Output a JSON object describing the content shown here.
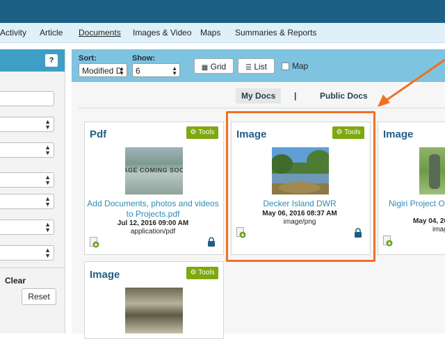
{
  "nav": {
    "items": [
      "Activity",
      "Article",
      "Documents",
      "Images & Video",
      "Maps",
      "Summaries & Reports"
    ],
    "active": "Documents"
  },
  "sidebar": {
    "help_label": "?",
    "clear_label": "Clear",
    "reset_label": "Reset"
  },
  "toolbar": {
    "sort_label": "Sort:",
    "sort_value": "Modified D",
    "show_label": "Show:",
    "show_value": "6",
    "grid_label": "Grid",
    "list_label": "List",
    "map_label": "Map"
  },
  "tabs": {
    "my_docs": "My Docs",
    "separator": "|",
    "public_docs": "Public Docs"
  },
  "cards": [
    {
      "title": "Pdf",
      "tools_label": "Tools",
      "thumb_text": "AGE COMING SOC",
      "link_line1": "Add Documents, photos and videos",
      "link_line2": "to Projects.pdf",
      "date": "Jul 12, 2016 09:00 AM",
      "mime": "application/pdf"
    },
    {
      "title": "Image",
      "tools_label": "Tools",
      "link_line1": "Decker Island DWR",
      "date": "May 06, 2016 08:37 AM",
      "mime": "image/png"
    },
    {
      "title": "Image",
      "link_line1": "Nigiri Project Op",
      "date": "May 04, 20",
      "mime": "imag"
    },
    {
      "title": "Image",
      "tools_label": "Tools"
    }
  ],
  "colors": {
    "header_blue": "#1e5f86",
    "toolbar_blue": "#7ec3e0",
    "tools_green": "#7ea80f",
    "link_blue": "#2a8bb5",
    "highlight_orange": "#f07020"
  }
}
